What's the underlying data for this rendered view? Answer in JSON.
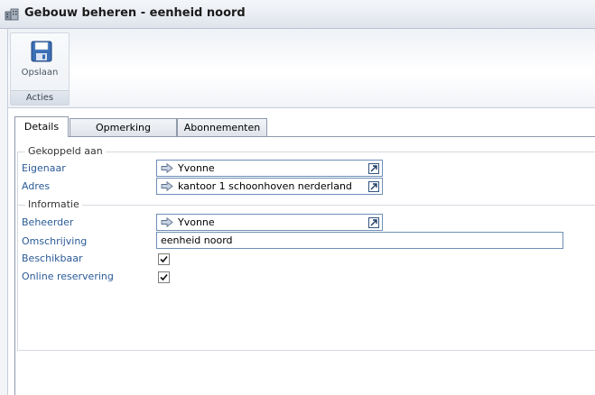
{
  "window": {
    "title": "Gebouw beheren - eenheid noord",
    "title_icon": "building-icon"
  },
  "ribbon": {
    "save_label": "Opslaan",
    "save_icon": "floppy-disk-icon",
    "group_label": "Acties"
  },
  "tabs": [
    {
      "label": "Details",
      "active": true
    },
    {
      "label": "Opmerking",
      "active": false
    },
    {
      "label": "Abonnementen",
      "active": false
    }
  ],
  "sections": {
    "linked": "Gekoppeld aan",
    "info": "Informatie"
  },
  "fields": {
    "owner": {
      "label": "Eigenaar",
      "value": "Yvonne"
    },
    "address": {
      "label": "Adres",
      "value": "kantoor 1 schoonhoven nerderland"
    },
    "manager": {
      "label": "Beheerder",
      "value": "Yvonne"
    },
    "description": {
      "label": "Omschrijving",
      "value": "eenheid noord"
    },
    "available": {
      "label": "Beschikbaar",
      "checked": true
    },
    "online_booking": {
      "label": "Online reservering",
      "checked": true
    }
  },
  "colors": {
    "label": "#2a5a96",
    "lookup_border": "#6f8fb8"
  }
}
